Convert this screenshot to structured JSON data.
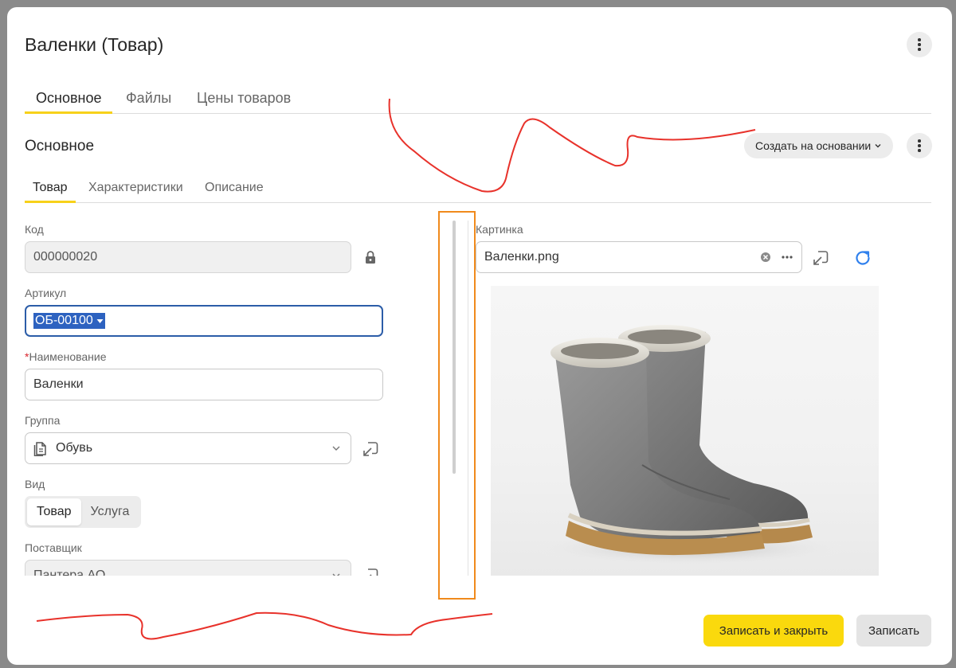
{
  "window": {
    "title": "Валенки (Товар)"
  },
  "tabs_top": [
    {
      "label": "Основное",
      "active": true
    },
    {
      "label": "Файлы",
      "active": false
    },
    {
      "label": "Цены товаров",
      "active": false
    }
  ],
  "section": {
    "title": "Основное",
    "create_based_label": "Создать на основании"
  },
  "tabs_sub": [
    {
      "label": "Товар",
      "active": true
    },
    {
      "label": "Характеристики",
      "active": false
    },
    {
      "label": "Описание",
      "active": false
    }
  ],
  "form": {
    "code": {
      "label": "Код",
      "value": "000000020"
    },
    "article": {
      "label": "Артикул",
      "value": "ОБ-00100"
    },
    "name": {
      "required_mark": "*",
      "label": "Наименование",
      "value": "Валенки"
    },
    "group": {
      "label": "Группа",
      "value": "Обувь"
    },
    "kind": {
      "label": "Вид",
      "options": [
        "Товар",
        "Услуга"
      ],
      "selected": "Товар"
    },
    "supplier": {
      "label": "Поставщик",
      "value": "Пантера АО"
    }
  },
  "picture": {
    "label": "Картинка",
    "value": "Валенки.png"
  },
  "footer": {
    "save_close_label": "Записать и закрыть",
    "save_label": "Записать"
  },
  "colors": {
    "accent": "#fad90d",
    "tab_underline": "#f7d11a",
    "focus": "#2c5da8",
    "selection": "#2d62c0",
    "required": "#d9262e",
    "refresh": "#2f80ed",
    "annotation_red": "#e8322b",
    "annotation_orange": "#f08a1c"
  },
  "icons": [
    "more-vertical-icon",
    "chevron-down-icon",
    "lock-icon",
    "document-icon",
    "open-link-icon",
    "clear-icon",
    "ellipsis-icon",
    "refresh-icon"
  ]
}
